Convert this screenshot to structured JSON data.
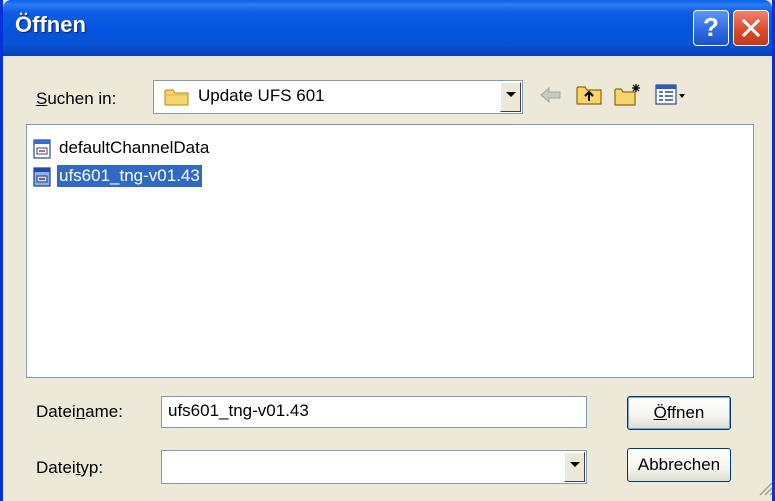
{
  "window": {
    "title": "Öffnen"
  },
  "lookin": {
    "label_pre": "S",
    "label_rest": "uchen in:",
    "value": "Update UFS 601"
  },
  "files": [
    {
      "name": "defaultChannelData",
      "selected": false
    },
    {
      "name": "ufs601_tng-v01.43",
      "selected": true
    }
  ],
  "filename": {
    "label_pre": "Datei",
    "label_u": "n",
    "label_rest": "ame:",
    "value": "ufs601_tng-v01.43"
  },
  "filetype": {
    "label_pre": "Datei",
    "label_u": "t",
    "label_rest": "yp:",
    "value": ""
  },
  "buttons": {
    "open_u": "Ö",
    "open_rest": "ffnen",
    "cancel": "Abbrechen"
  },
  "icons": [
    "help-icon",
    "close-icon",
    "folder-icon",
    "back-arrow-icon",
    "up-folder-icon",
    "new-folder-icon",
    "view-menu-icon",
    "file-icon"
  ],
  "colors": {
    "titlebar": "#0554e0",
    "selection": "#316ac5",
    "dialog": "#ece9d8"
  }
}
